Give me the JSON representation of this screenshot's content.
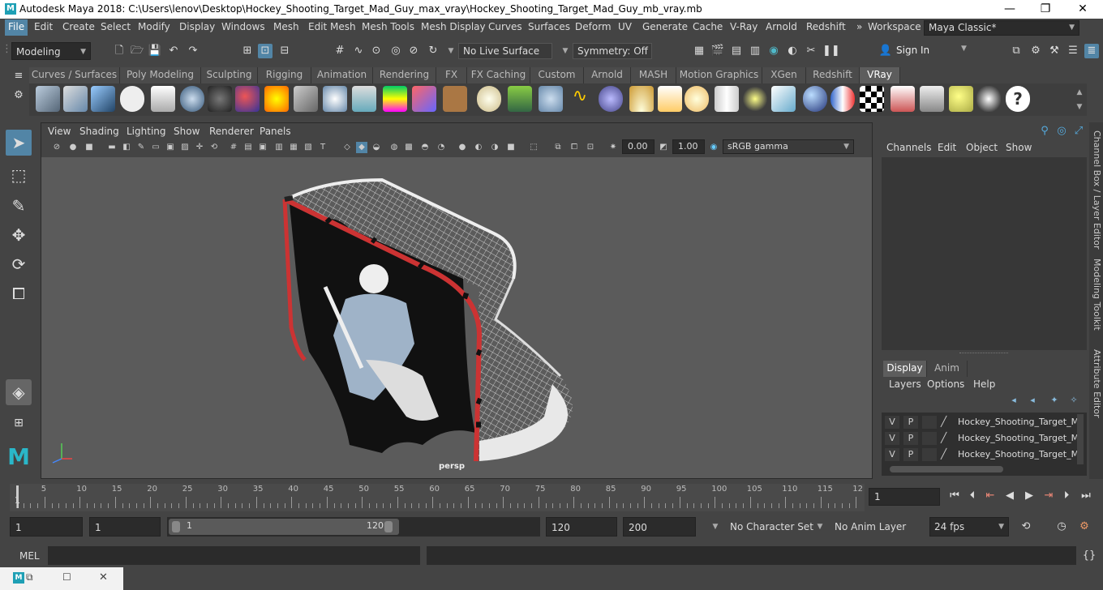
{
  "titlebar": {
    "title": "Autodesk Maya 2018: C:\\Users\\lenov\\Desktop\\Hockey_Shooting_Target_Mad_Guy_max_vray\\Hockey_Shooting_Target_Mad_Guy_mb_vray.mb",
    "minimize": "—",
    "maximize": "❐",
    "close": "✕"
  },
  "menubar": {
    "items": [
      "File",
      "Edit",
      "Create",
      "Select",
      "Modify",
      "Display",
      "Windows",
      "Mesh",
      "Edit Mesh",
      "Mesh Tools",
      "Mesh Display",
      "Curves",
      "Surfaces",
      "Deform",
      "UV",
      "Generate",
      "Cache",
      "V-Ray",
      "Arnold",
      "Redshift"
    ],
    "overflow": "»",
    "workspace_label": "Workspace :",
    "workspace_value": "Maya Classic*"
  },
  "statusline": {
    "mode": "Modeling",
    "live_surface": "No Live Surface",
    "symmetry": "Symmetry: Off",
    "sign_in": "Sign In"
  },
  "shelf": {
    "tabs": [
      "Curves / Surfaces",
      "Poly Modeling",
      "Sculpting",
      "Rigging",
      "Animation",
      "Rendering",
      "FX",
      "FX Caching",
      "Custom",
      "Arnold",
      "MASH",
      "Motion Graphics",
      "XGen",
      "Redshift",
      "VRay"
    ],
    "active_tab": "VRay"
  },
  "viewport": {
    "menus": [
      "View",
      "Shading",
      "Lighting",
      "Show",
      "Renderer",
      "Panels"
    ],
    "exposure": "0.00",
    "gamma": "1.00",
    "color_space": "sRGB gamma",
    "camera_label": "persp"
  },
  "channelbox": {
    "menus": [
      "Channels",
      "Edit",
      "Object",
      "Show"
    ]
  },
  "layereditor": {
    "tabs": [
      "Display",
      "Anim"
    ],
    "active_tab": "Display",
    "menus": [
      "Layers",
      "Options",
      "Help"
    ],
    "layers": [
      {
        "v": "V",
        "p": "P",
        "name": "Hockey_Shooting_Target_M"
      },
      {
        "v": "V",
        "p": "P",
        "name": "Hockey_Shooting_Target_M"
      },
      {
        "v": "V",
        "p": "P",
        "name": "Hockey_Shooting_Target_M"
      }
    ]
  },
  "sidetabs": [
    "Channel Box / Layer Editor",
    "Modeling Toolkit",
    "Attribute Editor"
  ],
  "timeslider": {
    "ticks": [
      "5",
      "10",
      "15",
      "20",
      "25",
      "30",
      "35",
      "40",
      "45",
      "50",
      "55",
      "60",
      "65",
      "70",
      "75",
      "80",
      "85",
      "90",
      "95",
      "100",
      "105",
      "110",
      "115",
      "12"
    ],
    "start_label": "1",
    "current_frame": "1"
  },
  "range": {
    "start": "1",
    "playback_start": "1",
    "slider_start": "1",
    "slider_end": "120",
    "playback_end": "120",
    "end": "200",
    "character_set": "No Character Set",
    "anim_layer": "No Anim Layer",
    "fps": "24 fps"
  },
  "commandline": {
    "label": "MEL"
  }
}
